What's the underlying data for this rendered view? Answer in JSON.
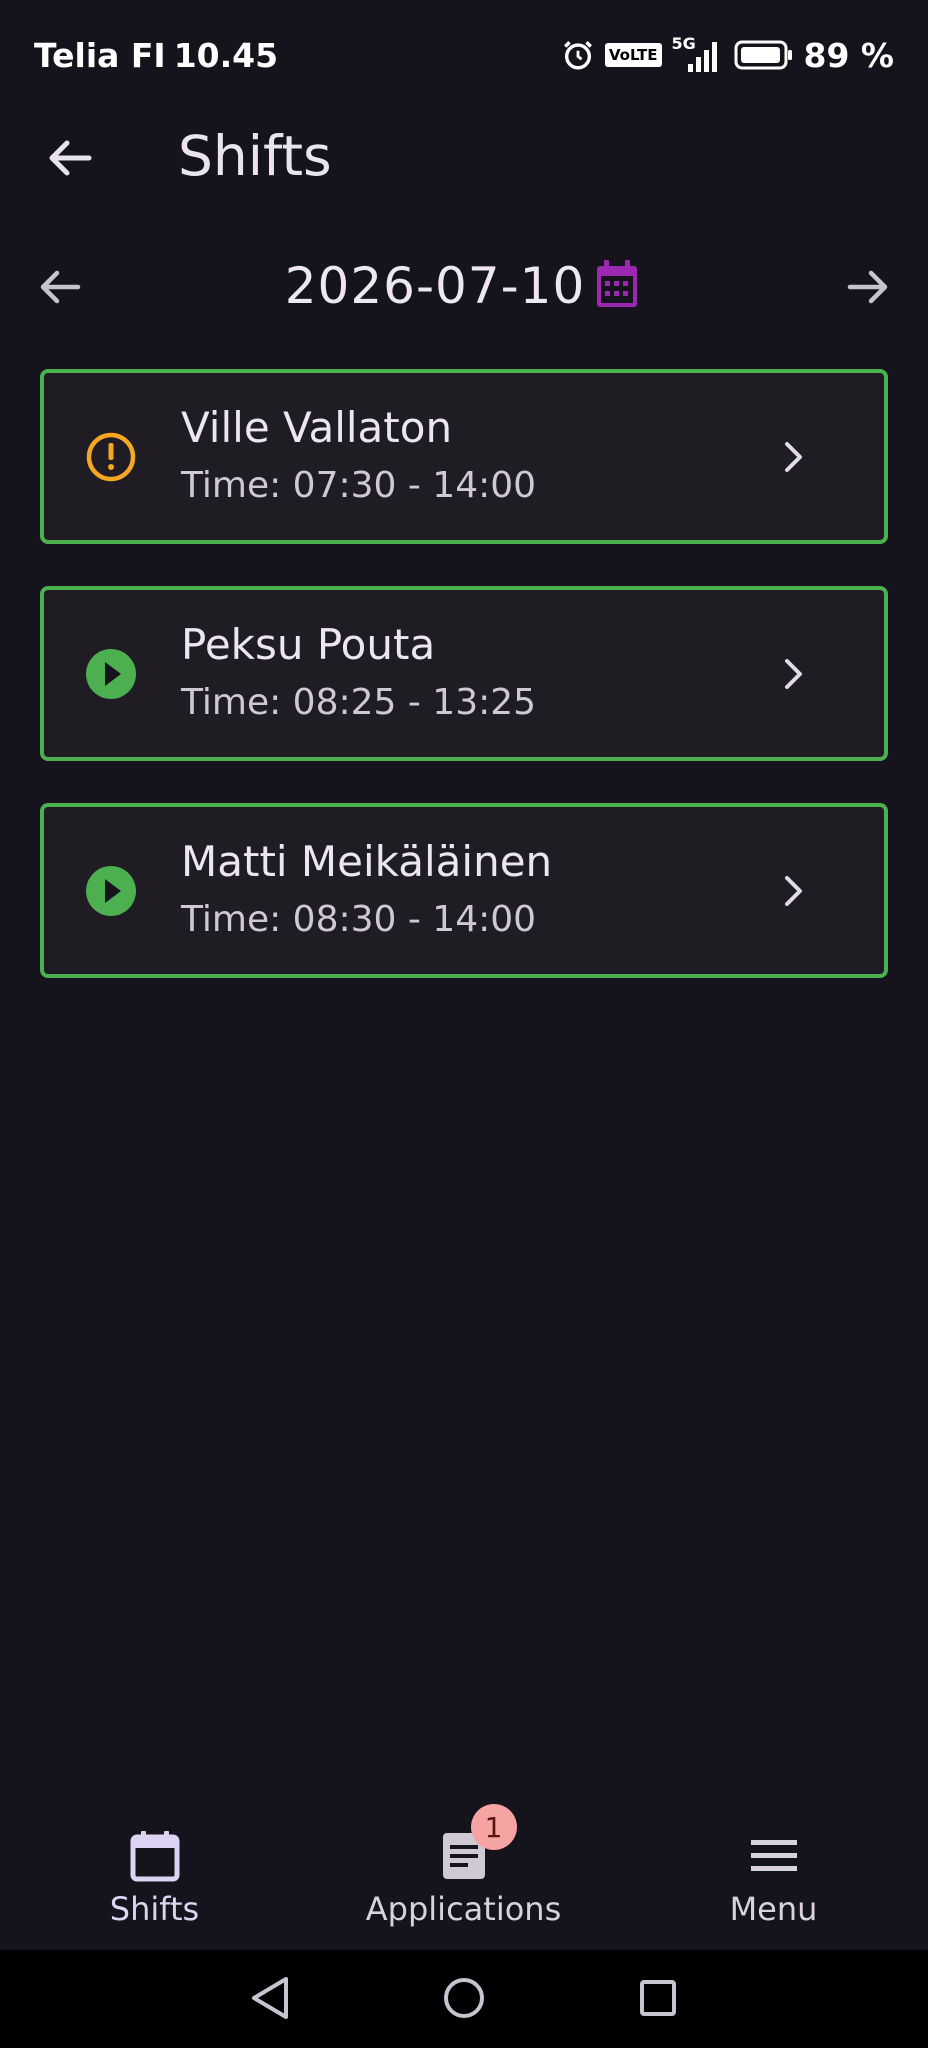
{
  "status_bar": {
    "carrier": "Telia FI",
    "time": "10.45",
    "network_type": "5G",
    "volte_label": "VoLTE",
    "battery": "89 %"
  },
  "app_bar": {
    "title": "Shifts"
  },
  "date_nav": {
    "date": "2026-07-10"
  },
  "shifts": [
    {
      "name": "Ville Vallaton",
      "time": "Time: 07:30 - 14:00",
      "status_icon": "warning-icon",
      "status_color": "#f5a623"
    },
    {
      "name": "Peksu Pouta",
      "time": "Time: 08:25 - 13:25",
      "status_icon": "play-icon",
      "status_color": "#4caf50"
    },
    {
      "name": "Matti Meikäläinen",
      "time": "Time: 08:30 - 14:00",
      "status_icon": "play-icon",
      "status_color": "#4caf50"
    }
  ],
  "colors": {
    "card_border": "#4caf50",
    "calendar_accent": "#9c27b0",
    "background": "#15131b"
  },
  "bottom_nav": {
    "items": [
      {
        "label": "Shifts",
        "icon": "calendar-icon",
        "active": true
      },
      {
        "label": "Applications",
        "icon": "document-icon",
        "badge": "1"
      },
      {
        "label": "Menu",
        "icon": "menu-icon"
      }
    ]
  }
}
